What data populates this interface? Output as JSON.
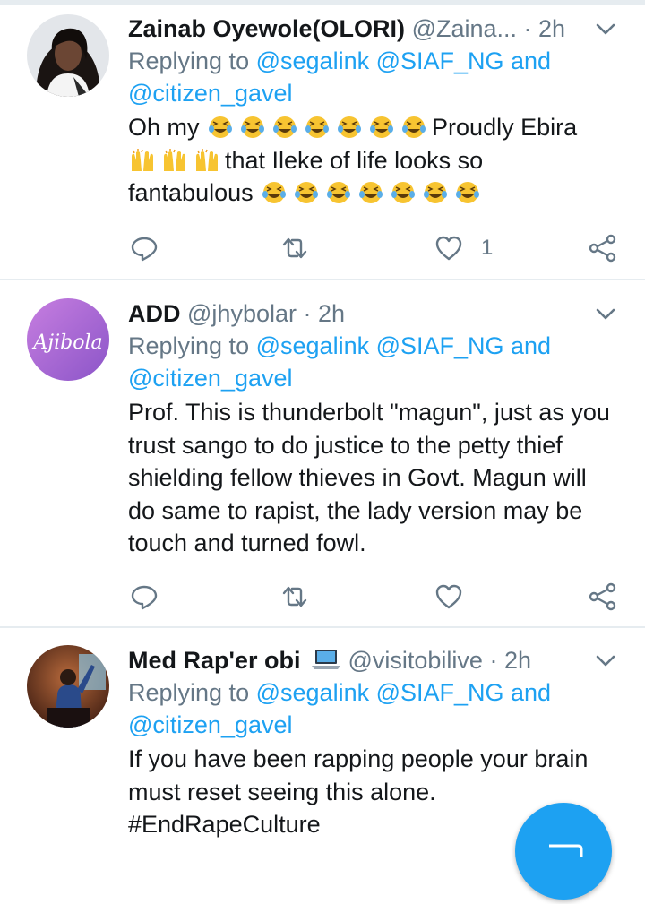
{
  "tweets": [
    {
      "name": "Zainab Oyewole(OLORI)",
      "handle": "@Zaina...",
      "time": "2h",
      "replying_prefix": "Replying to",
      "replying_users_line1": "@segalink @SIAF_NG and",
      "replying_users_line2": "@citizen_gavel",
      "text_parts": [
        "Oh my",
        "Proudly Ebira",
        "that Ileke of life looks so",
        "fantabulous"
      ],
      "like_count": "1",
      "avatar": "woman-portrait"
    },
    {
      "name": "ADD",
      "handle": "@jhybolar",
      "time": "2h",
      "replying_prefix": "Replying to",
      "replying_users_line1": "@segalink @SIAF_NG and",
      "replying_users_line2": "@citizen_gavel",
      "text": "Prof.  This is thunderbolt \"magun\", just as you trust sango to do justice to the petty thief shielding fellow thieves in Govt. Magun will do same to rapist,  the lady version may be touch and turned fowl.",
      "like_count": "",
      "avatar_text": "Ajibola"
    },
    {
      "name": "Med Rap'er obi",
      "handle": "@visitobilive",
      "time": "2h",
      "replying_prefix": "Replying to",
      "replying_users_line1": "@segalink @SIAF_NG and",
      "replying_users_line2": "@citizen_gavel",
      "text": "If you have been rapping people your brain must reset seeing this alone.",
      "hashtag": "#EndRapeCulture",
      "avatar": "person-at-board"
    }
  ],
  "icons": {
    "reply": "reply-icon",
    "retweet": "retweet-icon",
    "like": "heart-icon",
    "share": "share-icon",
    "caret": "chevron-down-icon",
    "compose": "compose-fab"
  },
  "colors": {
    "link": "#1da1f2",
    "secondary": "#657786",
    "text": "#14171a",
    "divider": "#e6ecf0"
  }
}
